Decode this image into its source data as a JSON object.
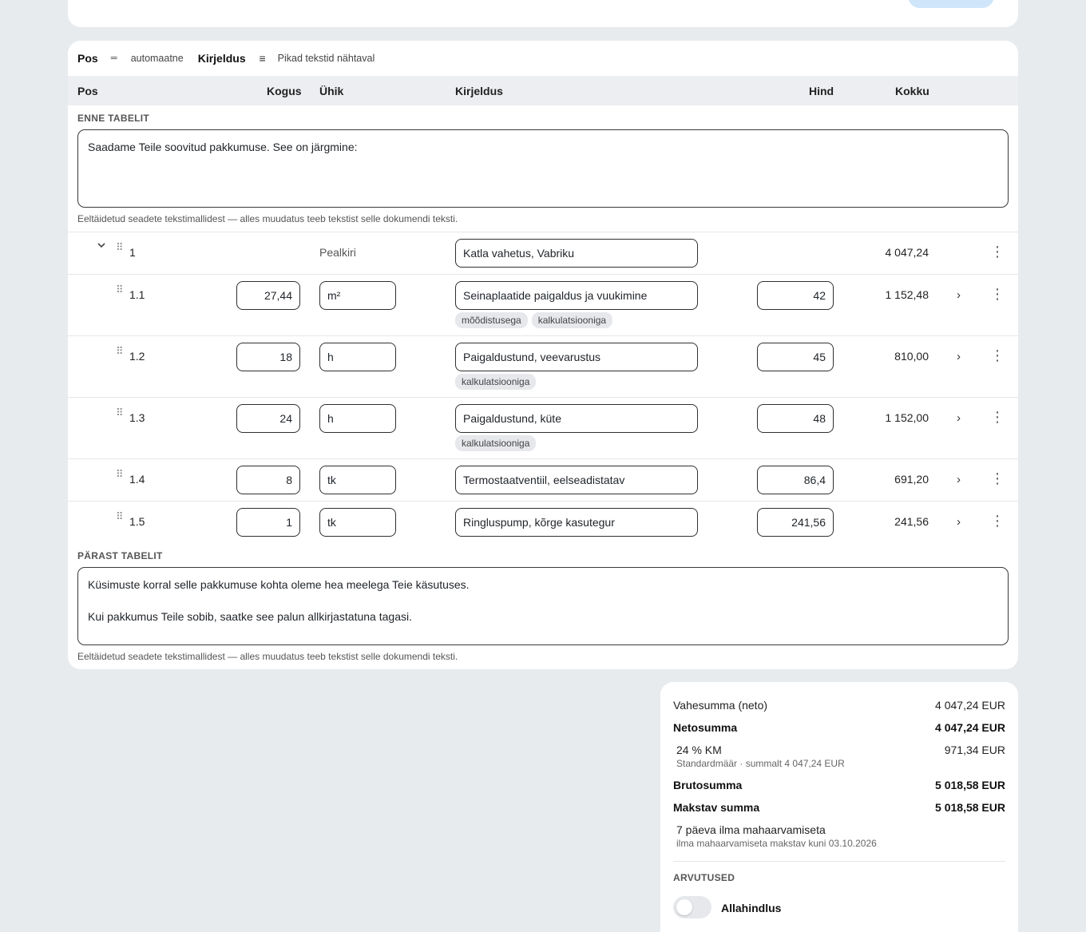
{
  "toolbar": {
    "pos_label": "Pos",
    "pos_value": "automaatne",
    "desc_label": "Kirjeldus",
    "desc_value": "Pikad tekstid nähtaval"
  },
  "columns": {
    "pos": "Pos",
    "qty": "Kogus",
    "unit": "Ühik",
    "desc": "Kirjeldus",
    "price": "Hind",
    "total": "Kokku"
  },
  "before": {
    "label": "ENNE TABELIT",
    "text": "Saadame Teile soovitud pakkumuse. See on järgmine:",
    "hint": "Eeltäidetud seadete tekstimallidest — alles muudatus teeb tekstist selle dokumendi teksti."
  },
  "heading_row": {
    "pos": "1",
    "unit": "Pealkiri",
    "desc": "Katla vahetus, Vabriku",
    "total": "4 047,24"
  },
  "rows": [
    {
      "pos": "1.1",
      "qty": "27,44",
      "unit": "m²",
      "desc": "Seinaplaatide paigaldus ja vuukimine",
      "price": "42",
      "total": "1 152,48",
      "tags": [
        "mõõdistusega",
        "kalkulatsiooniga"
      ]
    },
    {
      "pos": "1.2",
      "qty": "18",
      "unit": "h",
      "desc": "Paigaldustund, veevarustus",
      "price": "45",
      "total": "810,00",
      "tags": [
        "kalkulatsiooniga"
      ]
    },
    {
      "pos": "1.3",
      "qty": "24",
      "unit": "h",
      "desc": "Paigaldustund, küte",
      "price": "48",
      "total": "1 152,00",
      "tags": [
        "kalkulatsiooniga"
      ]
    },
    {
      "pos": "1.4",
      "qty": "8",
      "unit": "tk",
      "desc": "Termostaatventiil, eelseadistatav",
      "price": "86,4",
      "total": "691,20",
      "tags": []
    },
    {
      "pos": "1.5",
      "qty": "1",
      "unit": "tk",
      "desc": "Ringluspump, kõrge kasutegur",
      "price": "241,56",
      "total": "241,56",
      "tags": []
    }
  ],
  "after": {
    "label": "PÄRAST TABELIT",
    "text": "Küsimuste korral selle pakkumuse kohta oleme hea meelega Teie käsutuses.\n\nKui pakkumus Teile sobib, saatke see palun allkirjastatuna tagasi.",
    "hint": "Eeltäidetud seadete tekstimallidest — alles muudatus teeb tekstist selle dokumendi teksti."
  },
  "summary": {
    "subtotal_label": "Vahesumma (neto)",
    "subtotal_value": "4 047,24 EUR",
    "net_label": "Netosumma",
    "net_value": "4 047,24 EUR",
    "vat_label": "24 % KM",
    "vat_value": "971,34 EUR",
    "vat_sub": "Standardmäär · summalt 4 047,24 EUR",
    "gross_label": "Brutosumma",
    "gross_value": "5 018,58 EUR",
    "payable_label": "Makstav summa",
    "payable_value": "5 018,58 EUR",
    "terms": "7 päeva ilma mahaarvamiseta",
    "terms_sub": "ilma mahaarvamiseta makstav kuni 03.10.2026",
    "calc_label": "ARVUTUSED",
    "discount_label": "Allahindlus",
    "discount_enabled": false
  }
}
